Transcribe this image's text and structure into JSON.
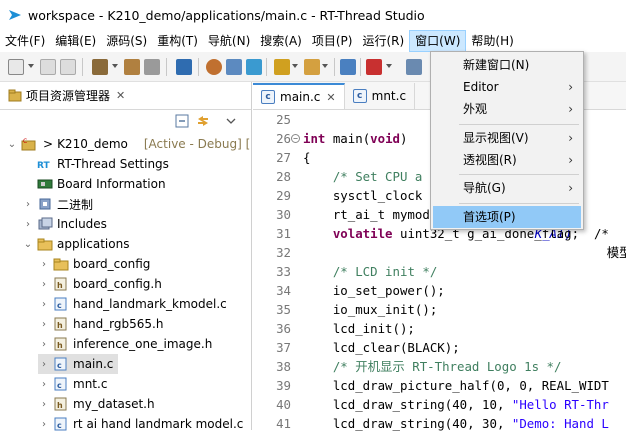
{
  "window": {
    "title": "workspace - K210_demo/applications/main.c - RT-Thread Studio"
  },
  "menubar": {
    "items": [
      "文件(F)",
      "编辑(E)",
      "源码(S)",
      "重构(T)",
      "导航(N)",
      "搜索(A)",
      "项目(P)",
      "运行(R)",
      "窗口(W)",
      "帮助(H)"
    ]
  },
  "window_menu": {
    "items": [
      {
        "label": "新建窗口(N)",
        "submenu": false,
        "highlighted": false
      },
      {
        "label": "Editor",
        "submenu": true,
        "highlighted": false
      },
      {
        "label": "外观",
        "submenu": true,
        "highlighted": false
      },
      {
        "label": "显示视图(V)",
        "submenu": true,
        "highlighted": false
      },
      {
        "label": "透视图(R)",
        "submenu": true,
        "highlighted": false
      },
      {
        "label": "导航(G)",
        "submenu": true,
        "highlighted": false
      },
      {
        "label": "首选项(P)",
        "submenu": false,
        "highlighted": true
      }
    ]
  },
  "left_panel": {
    "tab_label": "项目资源管理器",
    "close_glyph": "✕",
    "tree": [
      {
        "label": "K210_demo",
        "suffix": "[Active - Debug] [",
        "icon": "project-icon",
        "expanded": true
      },
      {
        "label": "RT-Thread Settings",
        "icon": "rt-settings-icon"
      },
      {
        "label": "Board Information",
        "icon": "board-icon"
      },
      {
        "label": "二进制",
        "icon": "binaries-icon"
      },
      {
        "label": "Includes",
        "icon": "includes-icon"
      },
      {
        "label": "applications",
        "icon": "folder-icon",
        "expanded": true
      },
      {
        "label": "board_config",
        "icon": "folder-icon"
      },
      {
        "label": "board_config.h",
        "icon": "h-file-icon"
      },
      {
        "label": "hand_landmark_kmodel.c",
        "icon": "c-file-icon"
      },
      {
        "label": "hand_rgb565.h",
        "icon": "h-file-icon"
      },
      {
        "label": "inference_one_image.h",
        "icon": "h-file-icon"
      },
      {
        "label": "main.c",
        "icon": "c-file-icon",
        "selected": true
      },
      {
        "label": "mnt.c",
        "icon": "c-file-icon"
      },
      {
        "label": "my_dataset.h",
        "icon": "h-file-icon"
      },
      {
        "label": "rt ai hand landmark model.c",
        "icon": "c-file-icon"
      }
    ]
  },
  "editor": {
    "tabs": [
      {
        "label": "main.c",
        "active": true,
        "close_glyph": "✕"
      },
      {
        "label": "mnt.c",
        "active": false
      }
    ],
    "lines": [
      {
        "n": "25",
        "html": ""
      },
      {
        "n": "26",
        "html": "<span class=\"kw\">int</span> main(<span class=\"kw\">void</span>)"
      },
      {
        "n": "27",
        "html": "{"
      },
      {
        "n": "28",
        "html": "    <span class=\"cm\">/* Set CPU a</span>"
      },
      {
        "n": "29",
        "html": "    sysctl_clock"
      },
      {
        "n": "30",
        "html": "    rt_ai_t mymod"
      },
      {
        "n": "31",
        "html": "    <span class=\"kw\">volatile</span> uint32_t g_ai_done_flag;  /*"
      },
      {
        "n": "32",
        "html": ""
      },
      {
        "n": "33",
        "html": "    <span class=\"cm\">/* LCD init */</span>"
      },
      {
        "n": "34",
        "html": "    io_set_power();"
      },
      {
        "n": "35",
        "html": "    io_mux_init();"
      },
      {
        "n": "36",
        "html": "    lcd_init();"
      },
      {
        "n": "37",
        "html": "    lcd_clear(BLACK);"
      },
      {
        "n": "38",
        "html": "    <span class=\"cm\">/* 开机显示 RT-Thread Logo 1s */</span>"
      },
      {
        "n": "39",
        "html": "    lcd_draw_picture_half(0, 0, REAL_WIDT"
      },
      {
        "n": "40",
        "html": "    lcd_draw_string(40, 10, <span class=\"str\">\"Hello RT-Thr</span>"
      },
      {
        "n": "41",
        "html": "    lcd_draw_string(40, 30, <span class=\"str\">\"Demo: Hand L</span>"
      }
    ],
    "overflow_fragments": {
      "line29": "K_AI)",
      "line30": "模型变"
    }
  }
}
